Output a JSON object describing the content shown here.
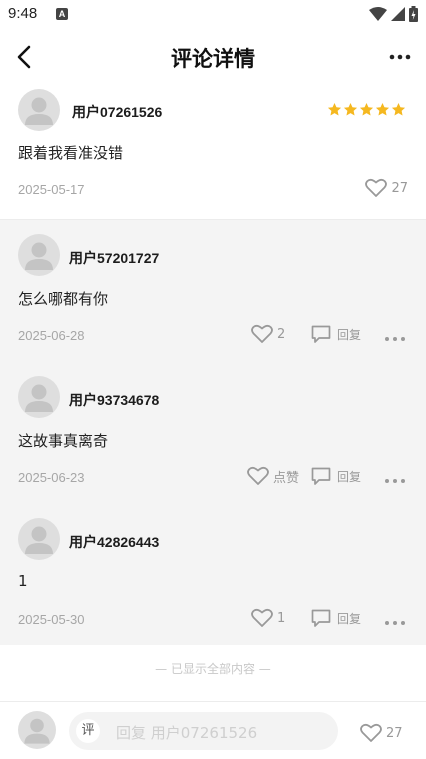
{
  "status": {
    "time": "9:48",
    "notification_icon": "A"
  },
  "header": {
    "title": "评论详情",
    "back_icon": "chevron-left-icon",
    "more_icon": "more-horizontal-icon"
  },
  "main_comment": {
    "username": "用户07261526",
    "rating": 5,
    "text": "跟着我看准没错",
    "date": "2025-05-17",
    "likes": "27"
  },
  "replies": [
    {
      "username": "用户57201727",
      "text": "怎么哪都有你",
      "date": "2025-06-28",
      "likes": "2",
      "reply_label": "回复"
    },
    {
      "username": "用户93734678",
      "text": "这故事真离奇",
      "date": "2025-06-23",
      "likes": "点赞",
      "reply_label": "回复"
    },
    {
      "username": "用户42826443",
      "text": "1",
      "date": "2025-05-30",
      "likes": "1",
      "reply_label": "回复"
    }
  ],
  "end_note": "— 已显示全部内容 —",
  "bottom_bar": {
    "badge": "评",
    "placeholder": "回复 用户07261526",
    "likes": "27"
  },
  "colors": {
    "star": "#f5b820",
    "muted": "#a6a6a6",
    "reply_bg": "#f4f4f4"
  }
}
